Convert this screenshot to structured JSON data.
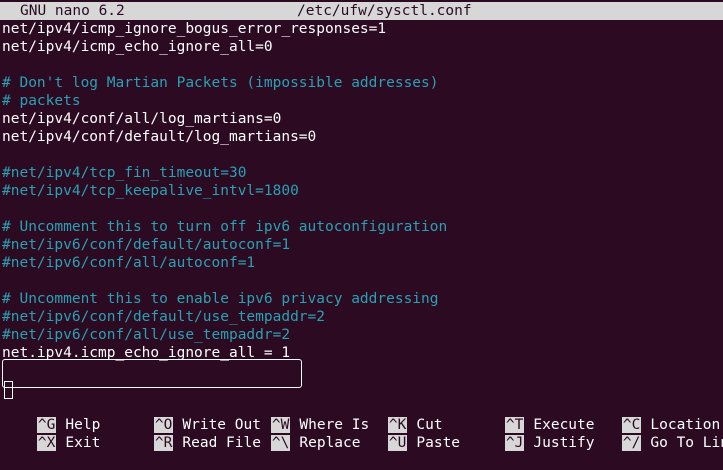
{
  "titlebar": {
    "app": "GNU nano 6.2",
    "filename": "/etc/ufw/sysctl.conf"
  },
  "lines": [
    {
      "text": "net/ipv4/icmp_ignore_bogus_error_responses=1",
      "type": "plain"
    },
    {
      "text": "net/ipv4/icmp_echo_ignore_all=0",
      "type": "plain"
    },
    {
      "text": "",
      "type": "plain"
    },
    {
      "text": "# Don't log Martian Packets (impossible addresses)",
      "type": "comment"
    },
    {
      "text": "# packets",
      "type": "comment"
    },
    {
      "text": "net/ipv4/conf/all/log_martians=0",
      "type": "plain"
    },
    {
      "text": "net/ipv4/conf/default/log_martians=0",
      "type": "plain"
    },
    {
      "text": "",
      "type": "plain"
    },
    {
      "text": "#net/ipv4/tcp_fin_timeout=30",
      "type": "comment"
    },
    {
      "text": "#net/ipv4/tcp_keepalive_intvl=1800",
      "type": "comment"
    },
    {
      "text": "",
      "type": "plain"
    },
    {
      "text": "# Uncomment this to turn off ipv6 autoconfiguration",
      "type": "comment"
    },
    {
      "text": "#net/ipv6/conf/default/autoconf=1",
      "type": "comment"
    },
    {
      "text": "#net/ipv6/conf/all/autoconf=1",
      "type": "comment"
    },
    {
      "text": "",
      "type": "plain"
    },
    {
      "text": "# Uncomment this to enable ipv6 privacy addressing",
      "type": "comment"
    },
    {
      "text": "#net/ipv6/conf/default/use_tempaddr=2",
      "type": "comment"
    },
    {
      "text": "#net/ipv6/conf/all/use_tempaddr=2",
      "type": "comment"
    },
    {
      "text": "net.ipv4.icmp_echo_ignore_all = 1",
      "type": "plain"
    }
  ],
  "shortcuts": {
    "row1": [
      {
        "key": "^G",
        "label": "Help"
      },
      {
        "key": "^O",
        "label": "Write Out"
      },
      {
        "key": "^W",
        "label": "Where Is"
      },
      {
        "key": "^K",
        "label": "Cut"
      },
      {
        "key": "^T",
        "label": "Execute"
      },
      {
        "key": "^C",
        "label": "Location"
      }
    ],
    "row2": [
      {
        "key": "^X",
        "label": "Exit"
      },
      {
        "key": "^R",
        "label": "Read File"
      },
      {
        "key": "^\\",
        "label": "Replace"
      },
      {
        "key": "^U",
        "label": "Paste"
      },
      {
        "key": "^J",
        "label": "Justify"
      },
      {
        "key": "^/",
        "label": "Go To Line"
      }
    ]
  },
  "colors": {
    "background": "#2b0a22",
    "comment": "#2aa1b3",
    "titlebar": "#d7d7d7"
  }
}
